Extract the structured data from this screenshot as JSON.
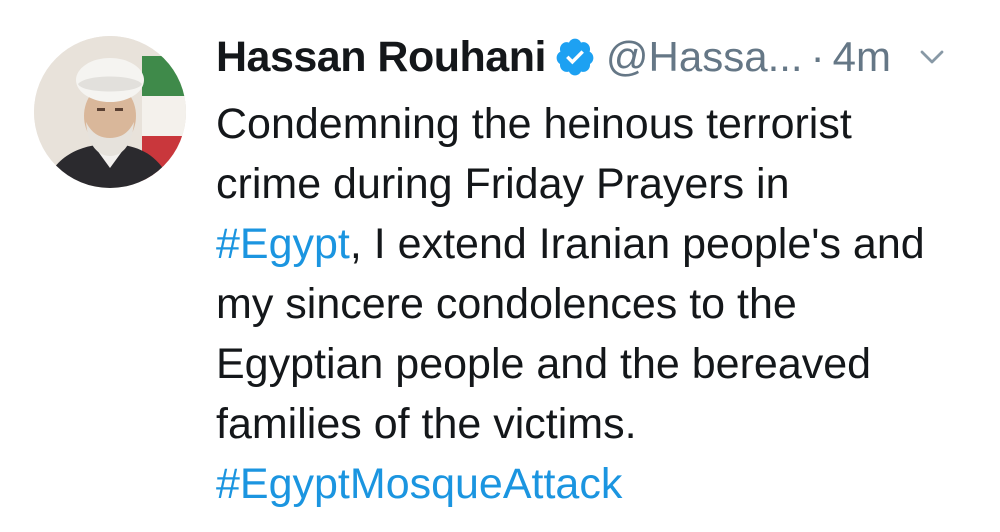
{
  "tweet": {
    "author_name": "Hassan Rouhani",
    "handle": "@Hassa...",
    "separator": "·",
    "timestamp": "4m",
    "icons": {
      "verified": "verified-badge-icon",
      "menu": "chevron-down-icon"
    },
    "colors": {
      "hashtag": "#1b95e0",
      "verified": "#1da1f2",
      "muted": "#657786",
      "text": "#14171a"
    },
    "body": {
      "line1": "Condemning the heinous terrorist",
      "line2": "crime during Friday Prayers in",
      "line3_hashtag": "#Egypt",
      "line3_rest": ", I extend Iranian people's and",
      "line4": "my sincere condolences to the",
      "line5": "Egyptian people and the bereaved",
      "line6": "families of the victims.",
      "line7_hashtag": "#EgyptMosqueAttack"
    }
  }
}
